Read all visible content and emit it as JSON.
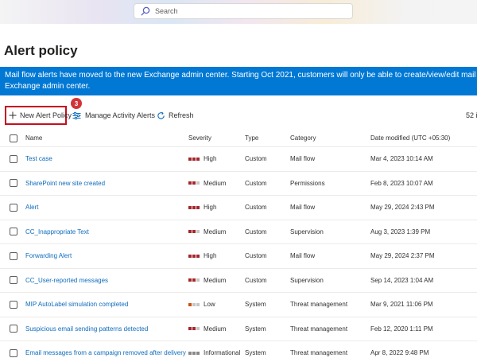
{
  "search": {
    "placeholder": "Search"
  },
  "page": {
    "title": "Alert policy"
  },
  "banner": {
    "line1": "Mail flow alerts have moved to the new Exchange admin center. Starting Oct 2021, customers will only be able to create/view/edit mail flow a",
    "line2": "Exchange admin center."
  },
  "toolbar": {
    "new_label": "New Alert Policy",
    "manage_label": "Manage Activity Alerts",
    "refresh_label": "Refresh",
    "step_badge": "3",
    "count_text": "52 i"
  },
  "table": {
    "columns": {
      "name": "Name",
      "severity": "Severity",
      "type": "Type",
      "category": "Category",
      "date": "Date modified (UTC +05:30)"
    },
    "rows": [
      {
        "name": "Test case",
        "severity": "High",
        "type": "Custom",
        "category": "Mail flow",
        "date": "Mar 4, 2023 10:14 AM"
      },
      {
        "name": "SharePoint new site created",
        "severity": "Medium",
        "type": "Custom",
        "category": "Permissions",
        "date": "Feb 8, 2023 10:07 AM"
      },
      {
        "name": "Alert",
        "severity": "High",
        "type": "Custom",
        "category": "Mail flow",
        "date": "May 29, 2024 2:43 PM"
      },
      {
        "name": "CC_Inappropriate Text",
        "severity": "Medium",
        "type": "Custom",
        "category": "Supervision",
        "date": "Aug 3, 2023 1:39 PM"
      },
      {
        "name": "Forwarding Alert",
        "severity": "High",
        "type": "Custom",
        "category": "Mail flow",
        "date": "May 29, 2024 2:37 PM"
      },
      {
        "name": "CC_User-reported messages",
        "severity": "Medium",
        "type": "Custom",
        "category": "Supervision",
        "date": "Sep 14, 2023 1:04 AM"
      },
      {
        "name": "MIP AutoLabel simulation completed",
        "severity": "Low",
        "type": "System",
        "category": "Threat management",
        "date": "Mar 9, 2021 11:06 PM"
      },
      {
        "name": "Suspicious email sending patterns detected",
        "severity": "Medium",
        "type": "System",
        "category": "Threat management",
        "date": "Feb 12, 2020 1:11 PM"
      },
      {
        "name": "Email messages from a campaign removed after delivery",
        "severity": "Informational",
        "type": "System",
        "category": "Threat management",
        "date": "Apr 8, 2022 9:48 PM"
      }
    ]
  },
  "severity_colors": {
    "High": [
      "#a4262c",
      "#a4262c",
      "#a4262c"
    ],
    "Medium": [
      "#a4262c",
      "#a4262c",
      "#c8c6c4"
    ],
    "Low": [
      "#ca5010",
      "#c8c6c4",
      "#c8c6c4"
    ],
    "Informational": [
      "#8a8886",
      "#8a8886",
      "#8a8886"
    ]
  },
  "colors": {
    "accent": "#0078d4",
    "link": "#0f6cbd",
    "highlight_border": "#c50f1f",
    "badge": "#d13438"
  }
}
